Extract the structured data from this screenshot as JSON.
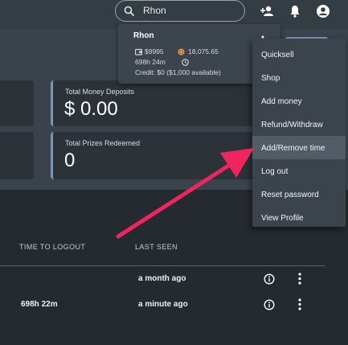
{
  "topbar": {
    "search_value": "Rhon",
    "icons": [
      "search-icon",
      "add-user-icon",
      "bell-icon",
      "account-circle-icon"
    ]
  },
  "cards": [
    {
      "label": "Total Money Deposits",
      "value": "$ 0.00"
    },
    {
      "label": "Total Prizes Redeemed",
      "value": "0"
    }
  ],
  "user_popup": {
    "name": "Rhon",
    "balance": "$9995",
    "points": "18,075.65",
    "time": "698h 24m",
    "credit": "Credit: $0 ($1,000 available)"
  },
  "menu": {
    "items": [
      {
        "label": "Quicksell"
      },
      {
        "label": "Shop"
      },
      {
        "label": "Add money"
      },
      {
        "label": "Refund/Withdraw"
      },
      {
        "label": "Add/Remove time"
      },
      {
        "label": "Log out"
      },
      {
        "label": "Reset password"
      },
      {
        "label": "View Profile"
      }
    ],
    "highlighted": "Add/Remove time"
  },
  "table": {
    "headers": {
      "time_to_logout": "TIME TO LOGOUT",
      "last_seen": "LAST SEEN"
    },
    "rows": [
      {
        "time_to_logout": "",
        "last_seen": "a month ago"
      },
      {
        "time_to_logout": "698h 22m",
        "last_seen": "a minute ago"
      }
    ]
  },
  "colors": {
    "accent": "#6a9cc6",
    "arrow": "#f0245e",
    "menu_bg": "#3b444c",
    "page_bg": "#242a2f"
  }
}
